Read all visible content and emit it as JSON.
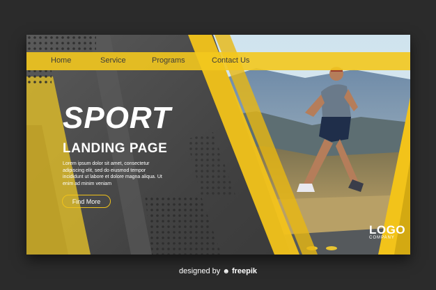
{
  "nav": {
    "items": [
      {
        "label": "Home"
      },
      {
        "label": "Service"
      },
      {
        "label": "Programs"
      },
      {
        "label": "Contact Us"
      }
    ]
  },
  "hero": {
    "title": "SPORT",
    "subtitle": "LANDING PAGE",
    "body": "Lorem ipsum dolor sit amet, consectetur adipiscing elit, sed do eiusmod tempor incididunt ut labore et dolore magna aliqua. Ut enim ad minim veniam",
    "cta_label": "Find More"
  },
  "logo": {
    "main": "LOGO",
    "sub": "COMPANY"
  },
  "credit": {
    "prefix": "designed by",
    "icon": "freepik-icon",
    "brand": "freepik"
  },
  "colors": {
    "accent": "#f2c31a",
    "dark": "#3f3f3f",
    "page_bg": "#2b2b2b"
  }
}
